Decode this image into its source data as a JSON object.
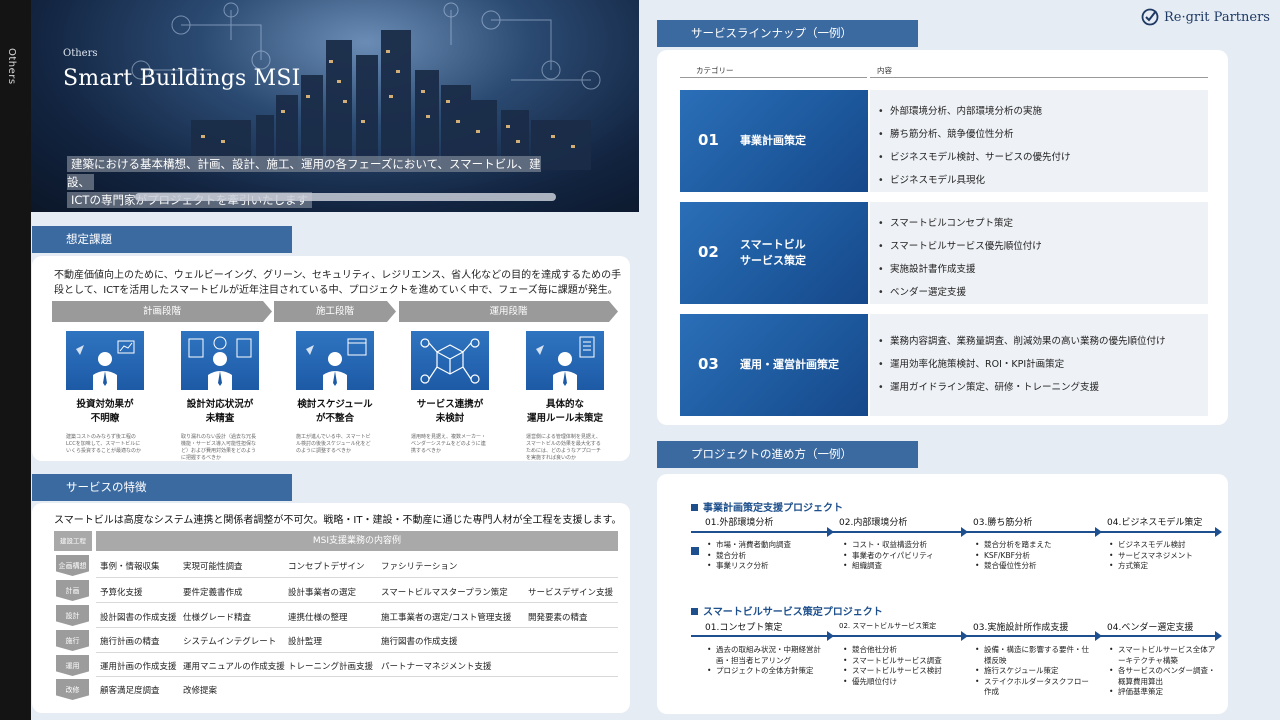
{
  "side_label": "Others",
  "hero": {
    "eyebrow": "Others",
    "title": "Smart Buildings MSI",
    "description_line1": "建築における基本構想、計画、設計、施工、運用の各フェーズにおいて、スマートビル、建設、",
    "description_line2": "ICTの専門家がプロジェクトを牽引いたします"
  },
  "assumed": {
    "header": "想定課題",
    "text": "不動産価値向上のために、ウェルビーイング、グリーン、セキュリティ、レジリエンス、省人化などの目的を達成するための手段として、ICTを活用したスマートビルが近年注目されている中、プロジェクトを進めていく中で、フェーズ毎に課題が発生。",
    "phases": [
      "計画段階",
      "施工段階",
      "運用段階"
    ],
    "issues": [
      {
        "title1": "投資対効果が",
        "title2": "不明瞭",
        "desc": "建築コストのみならず後工程のLCCを加味して、スマートビルにいくら投資することが最適なのか"
      },
      {
        "title1": "設計対応状況が",
        "title2": "未精査",
        "desc": "取り漏れのない設計（過去な冗長機能・サービス導入可能性担保など）および費用対効果をどのように把握するべきか"
      },
      {
        "title1": "検討スケジュール",
        "title2": "が不整合",
        "desc": "施工が進んでいる中、スマートビル検討の後後スケジュール化をどのように調整するべきか"
      },
      {
        "title1": "サービス連携が",
        "title2": "未検討",
        "desc": "運用時を見据え、複数メーカー・ベンダーシステムをどのように連携するべきか"
      },
      {
        "title1": "具体的な",
        "title2": "運用ルール未策定",
        "desc": "運営側による管理体制を見据え、スマートビルの効果を最大化するためには、どのようなアプローチを実施すれば良いのか"
      }
    ]
  },
  "features": {
    "header": "サービスの特徴",
    "text": "スマートビルは高度なシステム連携と関係者調整が不可欠。戦略・IT・建設・不動産に通じた専門人材が全工程を支援します。",
    "grid_left_header": "建設工程",
    "grid_right_header": "MSI支援業務の内容例",
    "rows": [
      {
        "stage": "企画構想",
        "cells": [
          "事例・情報収集",
          "実現可能性調査",
          "コンセプトデザイン",
          "ファシリテーション",
          ""
        ]
      },
      {
        "stage": "計画",
        "cells": [
          "予算化支援",
          "要件定義書作成",
          "設計事業者の選定",
          "スマートビルマスタープラン策定",
          "サービスデザイン支援"
        ]
      },
      {
        "stage": "設計",
        "cells": [
          "設計図書の作成支援",
          "仕様グレード精査",
          "連携仕様の整理",
          "施工事業者の選定/コスト管理支援",
          "開発要素の精査"
        ]
      },
      {
        "stage": "施行",
        "cells": [
          "施行計画の精査",
          "システムインテグレート",
          "設計監理",
          "施行図書の作成支援",
          ""
        ]
      },
      {
        "stage": "運用",
        "cells": [
          "運用計画の作成支援",
          "運用マニュアルの作成支援",
          "トレーニング計画支援",
          "パートナーマネジメント支援",
          ""
        ]
      },
      {
        "stage": "改修",
        "cells": [
          "顧客満足度調査",
          "改修提案",
          "",
          "",
          ""
        ]
      }
    ]
  },
  "logo": {
    "text": "Re·grit Partners"
  },
  "lineup": {
    "header": "サービスラインナップ（一例）",
    "col_category": "カテゴリー",
    "col_content": "内容",
    "items": [
      {
        "num": "01",
        "label1": "事業計画策定",
        "label2": "",
        "bullets": [
          "外部環境分析、内部環境分析の実施",
          "勝ち筋分析、競争優位性分析",
          "ビジネスモデル検討、サービスの優先付け",
          "ビジネスモデル具現化"
        ]
      },
      {
        "num": "02",
        "label1": "スマートビル",
        "label2": "サービス策定",
        "bullets": [
          "スマートビルコンセプト策定",
          "スマートビルサービス優先順位付け",
          "実施設計書作成支援",
          "ベンダー選定支援"
        ]
      },
      {
        "num": "03",
        "label1": "運用・運営計画策定",
        "label2": "",
        "bullets": [
          "業務内容調査、業務量調査、削減効果の高い業務の優先順位付け",
          "運用効率化施策検討、ROI・KPI計画策定",
          "運用ガイドライン策定、研修・トレーニング支援"
        ]
      }
    ]
  },
  "projects": {
    "header": "プロジェクトの進め方（一例）",
    "flows": [
      {
        "title": "事業計画策定支援プロジェクト",
        "steps": [
          {
            "label": "01.外部環境分析",
            "bullets": [
              "市場・消費者動向調査",
              "競合分析",
              "事業リスク分析"
            ]
          },
          {
            "label": "02.内部環境分析",
            "bullets": [
              "コスト・収益構造分析",
              "事業者のケイパビリティ",
              "組織調査"
            ]
          },
          {
            "label": "03.勝ち筋分析",
            "bullets": [
              "競合分析を踏まえた",
              "KSF/KBF分析",
              "競合優位性分析"
            ]
          },
          {
            "label": "04.ビジネスモデル策定",
            "bullets": [
              "ビジネスモデル検討",
              "サービスマネジメント",
              "方式策定"
            ]
          }
        ]
      },
      {
        "title": "スマートビルサービス策定プロジェクト",
        "steps": [
          {
            "label": "01.コンセプト策定",
            "bullets": [
              "過去の取組み状況・中期経営計画・担当者ヒアリング",
              "プロジェクトの全体方針策定"
            ]
          },
          {
            "label": "02. スマートビルサービス策定",
            "bullets": [
              "競合他社分析",
              "スマートビルサービス調査",
              "スマートビルサービス検討",
              "優先順位付け"
            ]
          },
          {
            "label": "03.実施設計所作成支援",
            "bullets": [
              "設備・構造に影響する要件・仕様反映",
              "施行スケジュール策定",
              "ステイクホルダータスクフロー作成"
            ]
          },
          {
            "label": "04.ベンダー選定支援",
            "bullets": [
              "スマートビルサービス全体アーキテクチャ構築",
              "各サービスのベンダー調査・概算費用算出",
              "評価基準策定"
            ]
          }
        ]
      }
    ]
  }
}
